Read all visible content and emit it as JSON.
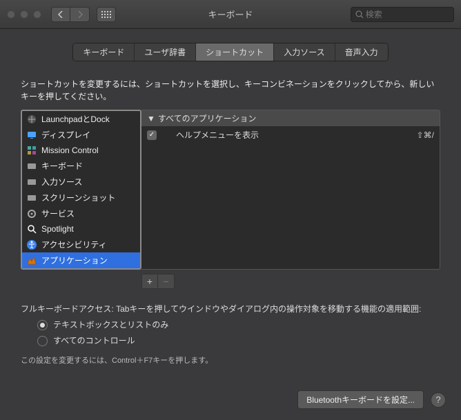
{
  "window": {
    "title": "キーボード"
  },
  "search": {
    "placeholder": "検索"
  },
  "tabs": {
    "items": [
      "キーボード",
      "ユーザ辞書",
      "ショートカット",
      "入力ソース",
      "音声入力"
    ],
    "selected": 2
  },
  "instruction": "ショートカットを変更するには、ショートカットを選択し、キーコンビネーションをクリックしてから、新しいキーを押してください。",
  "categories": [
    {
      "icon": "launchpad",
      "label": "LaunchpadとDock"
    },
    {
      "icon": "display",
      "label": "ディスプレイ"
    },
    {
      "icon": "mission",
      "label": "Mission Control"
    },
    {
      "icon": "keyboard",
      "label": "キーボード"
    },
    {
      "icon": "input",
      "label": "入力ソース"
    },
    {
      "icon": "screenshot",
      "label": "スクリーンショット"
    },
    {
      "icon": "services",
      "label": "サービス"
    },
    {
      "icon": "spotlight",
      "label": "Spotlight"
    },
    {
      "icon": "accessibility",
      "label": "アクセシビリティ"
    },
    {
      "icon": "apps",
      "label": "アプリケーション"
    }
  ],
  "selected_category": 9,
  "detail": {
    "header": "すべてのアプリケーション",
    "items": [
      {
        "checked": true,
        "label": "ヘルプメニューを表示",
        "shortcut": "⇧⌘/"
      }
    ]
  },
  "buttons": {
    "add": "+",
    "remove": "−"
  },
  "kbaccess": {
    "label": "フルキーボードアクセス: Tabキーを押してウインドウやダイアログ内の操作対象を移動する機能の適用範囲:",
    "options": [
      "テキストボックスとリストのみ",
      "すべてのコントロール"
    ],
    "selected": 0,
    "hint": "この設定を変更するには、Control＋F7キーを押します。"
  },
  "footer": {
    "bluetooth": "Bluetoothキーボードを設定...",
    "help": "?"
  }
}
